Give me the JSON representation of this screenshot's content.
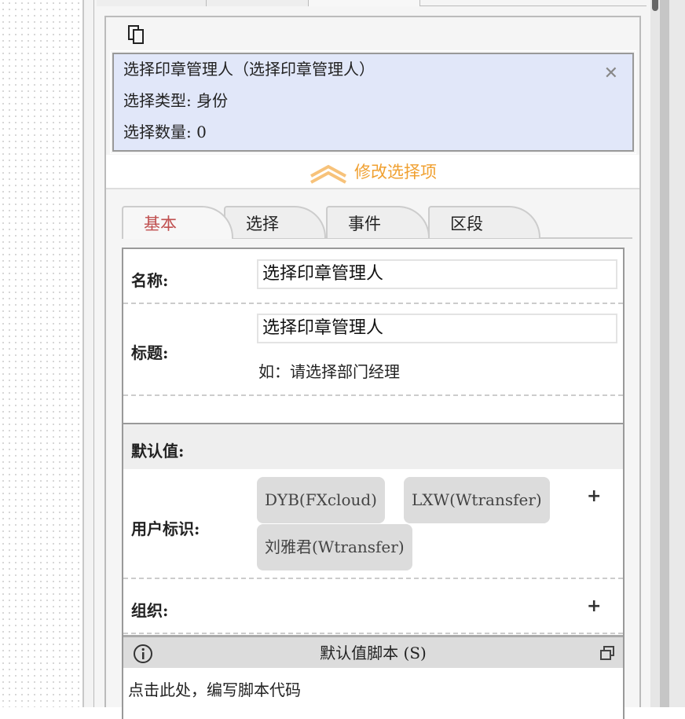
{
  "selection": {
    "title": "选择印章管理人（选择印章管理人）",
    "type_line": "选择类型: 身份",
    "count_line": "选择数量: 0"
  },
  "modify_label": "修改选择项",
  "tabs": [
    {
      "label": "基本"
    },
    {
      "label": "选择"
    },
    {
      "label": "事件"
    },
    {
      "label": "区段"
    }
  ],
  "form": {
    "name_label": "名称:",
    "name_value": "选择印章管理人",
    "title_label": "标题:",
    "title_value": "选择印章管理人",
    "title_hint": "如：请选择部门经理",
    "default_label": "默认值:",
    "user_label": "用户标识:",
    "users": [
      "DYB(FXcloud)",
      "LXW(Wtransfer)",
      "刘雅君(Wtransfer)"
    ],
    "org_label": "组织:",
    "plus": "+",
    "script_title": "默认值脚本 (S)",
    "script_placeholder": "点击此处，编写脚本代码"
  },
  "colors": {
    "accent": "#f0a030",
    "active_tab": "#c05050",
    "selection_bg": "#e1e7f9"
  }
}
